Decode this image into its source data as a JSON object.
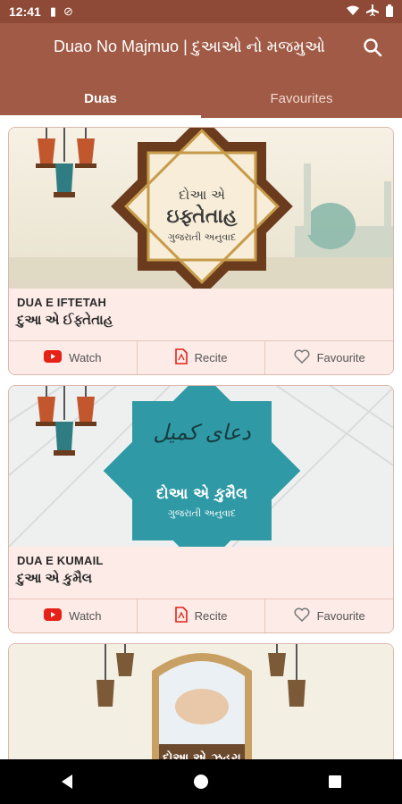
{
  "status": {
    "time": "12:41"
  },
  "appbar": {
    "title": "Duao No Majmuo | દુઆઓ નો મજમુઓ"
  },
  "tabs": [
    {
      "label": "Duas",
      "active": true
    },
    {
      "label": "Favourites",
      "active": false
    }
  ],
  "cards": [
    {
      "name_en": "DUA E IFTETAH",
      "name_gu": "દુઆ એ ઈફ્તેતાહ",
      "banner_title": "દોઆ એ",
      "banner_title2": "ઇફ્તેતાહ",
      "banner_sub": "ગુજરાતી અનુવાદ"
    },
    {
      "name_en": "DUA E KUMAIL",
      "name_gu": "દુઆ એ કુમૈલ",
      "banner_title": "દોઆ એ કુમૈલ",
      "banner_sub": "ગુજરાતી અનુવાદ"
    },
    {
      "banner_title": "દોઆ એ ઝહરા"
    }
  ],
  "actions": {
    "watch": "Watch",
    "recite": "Recite",
    "favourite": "Favourite"
  },
  "colors": {
    "appbar": "#a05a45",
    "statusbar": "#8e4a37",
    "card_bg": "#fcebe6",
    "youtube": "#e62117"
  }
}
